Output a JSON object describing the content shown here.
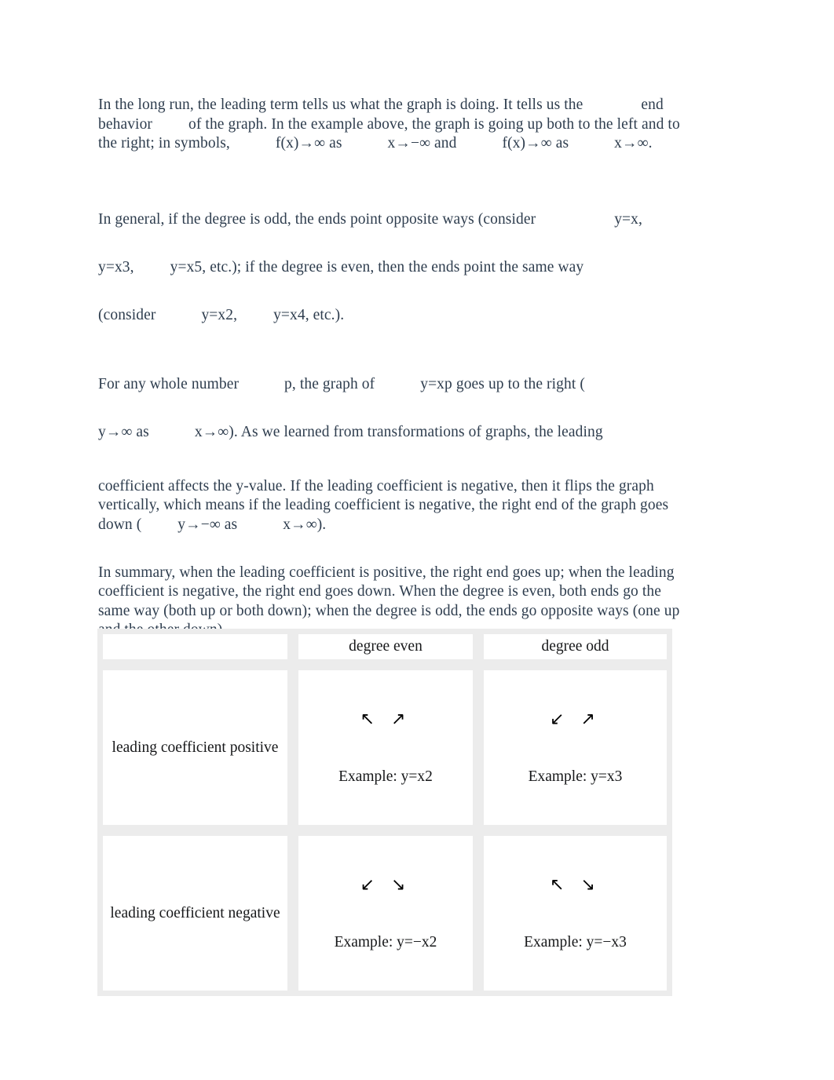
{
  "document": {
    "paragraphs": [
      {
        "id": "p-long-run",
        "segments": [
          {
            "text": "In the long run, the leading term tells us what the graph is doing. It tells us the"
          },
          {
            "gap": "lg"
          },
          {
            "text": "end behavior"
          },
          {
            "gap": "sm"
          },
          {
            "text": "of the graph. In the example above, the graph is going up both to the left and to the right; in symbols,"
          },
          {
            "gap": "md"
          },
          {
            "text": "f(x)→∞ as"
          },
          {
            "gap": "md"
          },
          {
            "text": "x→−∞ and"
          },
          {
            "gap": "md"
          },
          {
            "text": "f(x)→∞ as"
          },
          {
            "gap": "md"
          },
          {
            "text": "x→∞."
          }
        ],
        "full_text": "In the long run, the leading term tells us what the graph is doing. It tells us the end behavior of the graph. In the example above, the graph is going up both to the left and to the right; in symbols, f(x)→∞ as x→−∞ and f(x)→∞ as x→∞."
      },
      {
        "id": "p-in-general",
        "full_text": "In general, if the degree is odd, the ends point opposite ways (consider y=x, y=x3, y=x5, etc.); if the degree is even, then the ends point the same way (consider y=x2, y=x4, etc.).",
        "line1_a": "In general, if the degree is odd, the ends point opposite ways (consider",
        "line1_b": "y=x,",
        "line2_a": "y=x3,",
        "line2_b": "y=x5, etc.); if the degree is even, then the ends point the same way",
        "line3_a": "(consider",
        "line3_b": "y=x2,",
        "line3_c": "y=x4, etc.)."
      },
      {
        "id": "p-whole-number",
        "full_text": "For any whole number p, the graph of y=xp goes up to the right ( y→∞ as x→∞). As we learned from transformations of graphs, the leading",
        "line1_a": "For any whole number",
        "line1_b": "p, the graph of",
        "line1_c": "y=xp goes up to the right (",
        "line2_a": "y→∞ as",
        "line2_b": "x→∞). As we learned from transformations of graphs, the leading"
      },
      {
        "id": "p-coefficient",
        "full_text": "coefficient affects the y-value. If the leading coefficient is negative, then it flips the graph vertically, which means if the leading coefficient is negative, the right end of the graph goes down ( y→−∞ as x→∞).",
        "part_a": "coefficient affects the y-value. If the leading coefficient is negative, then it flips the graph vertically, which means if the leading coefficient is negative, the right end of the graph goes down (",
        "part_b": "y→−∞ as",
        "part_c": "x→∞)."
      },
      {
        "id": "p-summary",
        "full_text": "In summary, when the leading coefficient is positive, the right end goes up; when the leading coefficient is negative, the right end goes down. When the degree is even, both ends go the same way (both up or both down); when the degree is odd, the ends go opposite ways (one up and the other down)."
      }
    ]
  },
  "table": {
    "corner_label": "",
    "column_headers": [
      "",
      "degree even",
      "degree odd"
    ],
    "rows": [
      {
        "label": "leading coefficient positive",
        "cells": [
          {
            "arrows": "↖ ↗",
            "example": "Example: y=x2"
          },
          {
            "arrows": "↙ ↗",
            "example": "Example: y=x3"
          }
        ]
      },
      {
        "label": "leading coefficient negative",
        "cells": [
          {
            "arrows": "↙ ↘",
            "example": "Example: y=−x2"
          },
          {
            "arrows": "↖ ↘",
            "example": "Example: y=−x3"
          }
        ]
      }
    ]
  },
  "colors": {
    "body_text": "#2e3d4e",
    "table_text": "#17181a",
    "table_border": "#ececec",
    "page_background": "#ffffff"
  }
}
